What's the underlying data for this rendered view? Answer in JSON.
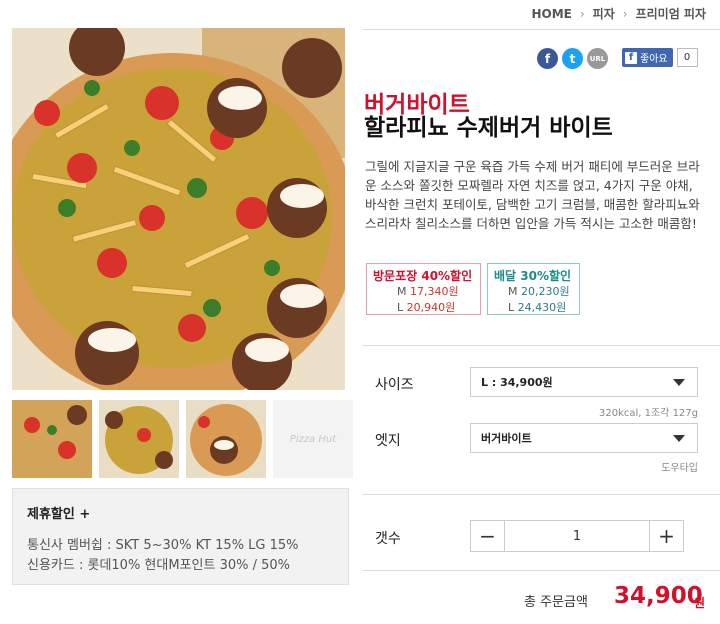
{
  "breadcrumb": {
    "home": "HOME",
    "category": "피자",
    "sub": "프리미엄 피자"
  },
  "share": {
    "facebook": "f",
    "twitter": "t",
    "url": "URL",
    "like_label": "좋아요",
    "like_count": "0"
  },
  "product": {
    "sub_name": "버거바이트",
    "name": "할라피뇨 수제버거 바이트",
    "description": "그릴에 지글지글 구운 육즙 가득 수제 버거 패티에 부드러운 브라운 소스와 쫄깃한 모짜렐라 자연 치즈를 얹고, 4가지 구운 야채, 바삭한 크런치 포테이토, 담백한 고기 크럼블, 매콤한 할라피뇨와 스리라차 칠리소스를 더하면 입안을 가득 적시는 고소한 매콤함!"
  },
  "prices": {
    "pickup": {
      "title": "방문포장 40%할인",
      "m_label": "M",
      "m": "17,340원",
      "l_label": "L",
      "l": "20,940원"
    },
    "delivery": {
      "title": "배달 30%할인",
      "m_label": "M",
      "m": "20,230원",
      "l_label": "L",
      "l": "24,430원"
    }
  },
  "options": {
    "size_label": "사이즈",
    "size_value": "L : 34,900원",
    "size_note": "320kcal, 1조각 127g",
    "edge_label": "엣지",
    "edge_value": "버거바이트",
    "edge_note": "도우타입",
    "qty_label": "갯수",
    "qty_minus": "−",
    "qty_value": "1",
    "qty_plus": "+"
  },
  "total": {
    "label": "총 주문금액",
    "value": "34,900",
    "unit": "원"
  },
  "promo": {
    "title": "제휴할인 +",
    "line1": "통신사 멤버쉽 : SKT 5~30% KT 15% LG 15%",
    "line2": "신용카드 : 롯데10% 현대M포인트 30% / 50%"
  },
  "thumbnail_logo": "Pizza Hut"
}
